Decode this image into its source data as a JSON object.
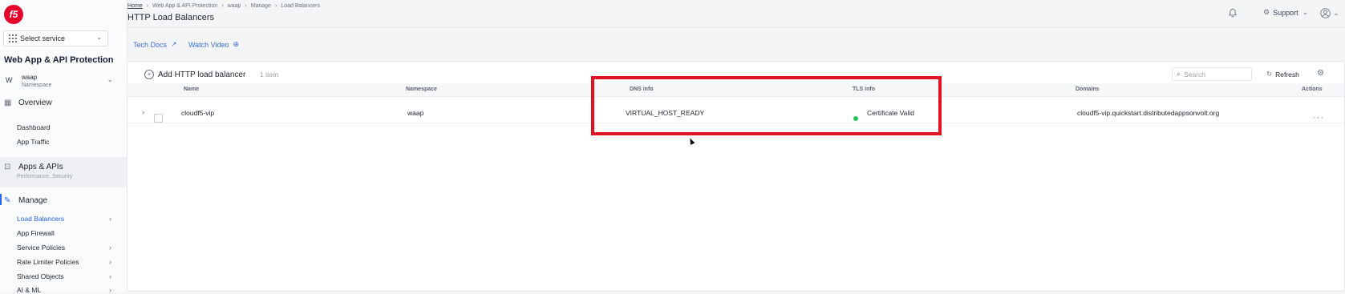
{
  "sidebar": {
    "logo_text": "f5",
    "select_service": "Select service",
    "service_title": "Web App & API Protection",
    "namespace": {
      "avatar": "W",
      "name": "waap",
      "label": "Namespace"
    },
    "overview": {
      "label": "Overview",
      "items": [
        "Dashboard",
        "App Traffic"
      ]
    },
    "apps": {
      "label": "Apps & APIs",
      "subtitle": "Performance, Security"
    },
    "manage": {
      "label": "Manage",
      "items": [
        {
          "label": "Load Balancers",
          "active": true,
          "chevron": true
        },
        {
          "label": "App Firewall",
          "active": false,
          "chevron": false
        },
        {
          "label": "Service Policies",
          "active": false,
          "chevron": true
        },
        {
          "label": "Rate Limiter Policies",
          "active": false,
          "chevron": true
        },
        {
          "label": "Shared Objects",
          "active": false,
          "chevron": true
        },
        {
          "label": "AI & ML",
          "active": false,
          "chevron": true
        }
      ]
    }
  },
  "header": {
    "breadcrumb": [
      "Home",
      "Web App & API Protection",
      "waap",
      "Manage",
      "Load Balancers"
    ],
    "title": "HTTP Load Balancers",
    "support_label": "Support"
  },
  "doc_links": {
    "tech_docs": "Tech Docs",
    "watch_video": "Watch Video"
  },
  "toolbar": {
    "add_label": "Add HTTP load balancer",
    "count": "1 item",
    "search_placeholder": "Search",
    "refresh_label": "Refresh"
  },
  "table": {
    "headers": {
      "name": "Name",
      "namespace": "Namespace",
      "dns": "DNS info",
      "tls": "TLS info",
      "domains": "Domains",
      "actions": "Actions"
    },
    "rows": [
      {
        "name": "cloudf5-vip",
        "namespace": "waap",
        "dns": "VIRTUAL_HOST_READY",
        "tls": "Certificate Valid",
        "domains": "cloudf5-vip.quickstart.distributedappsonvolt.org"
      }
    ]
  },
  "colors": {
    "accent": "#2563eb",
    "highlight": "#e0141e",
    "status_ok": "#22c55e",
    "brand": "#e4002b"
  }
}
